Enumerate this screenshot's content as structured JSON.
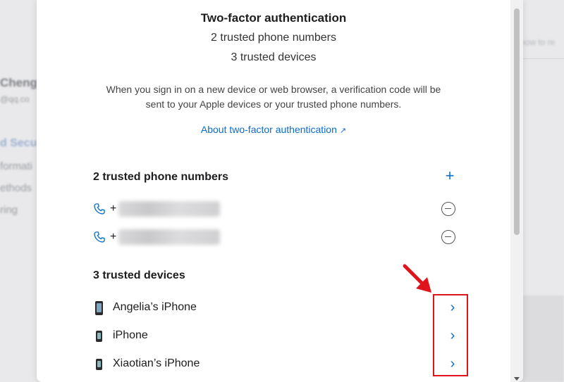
{
  "background": {
    "name_fragment": "Cheng",
    "email_fragment": "@qq.co",
    "section_fragment": "d Secu",
    "info_fragment": "formati",
    "methods_fragment": "ethods",
    "ring_fragment": "ring",
    "howto_fragment": "how to re"
  },
  "modal": {
    "title": "Two-factor authentication",
    "phone_summary": "2 trusted phone numbers",
    "device_summary": "3 trusted devices",
    "description": "When you sign in on a new device or web browser, a verification code will be sent to your Apple devices or your trusted phone numbers.",
    "about_link": "About two-factor authentication",
    "about_link_arrow": "↗"
  },
  "phones": {
    "section_title": "2 trusted phone numbers",
    "add_symbol": "+",
    "items": [
      {
        "prefix": "+"
      },
      {
        "prefix": "+"
      }
    ]
  },
  "devices": {
    "section_title": "3 trusted devices",
    "chevron": "›",
    "items": [
      {
        "name": "Angelia’s iPhone"
      },
      {
        "name": "iPhone"
      },
      {
        "name": "Xiaotian’s iPhone"
      }
    ]
  },
  "colors": {
    "accent": "#0a6ccf",
    "annotation": "#e0141b"
  }
}
